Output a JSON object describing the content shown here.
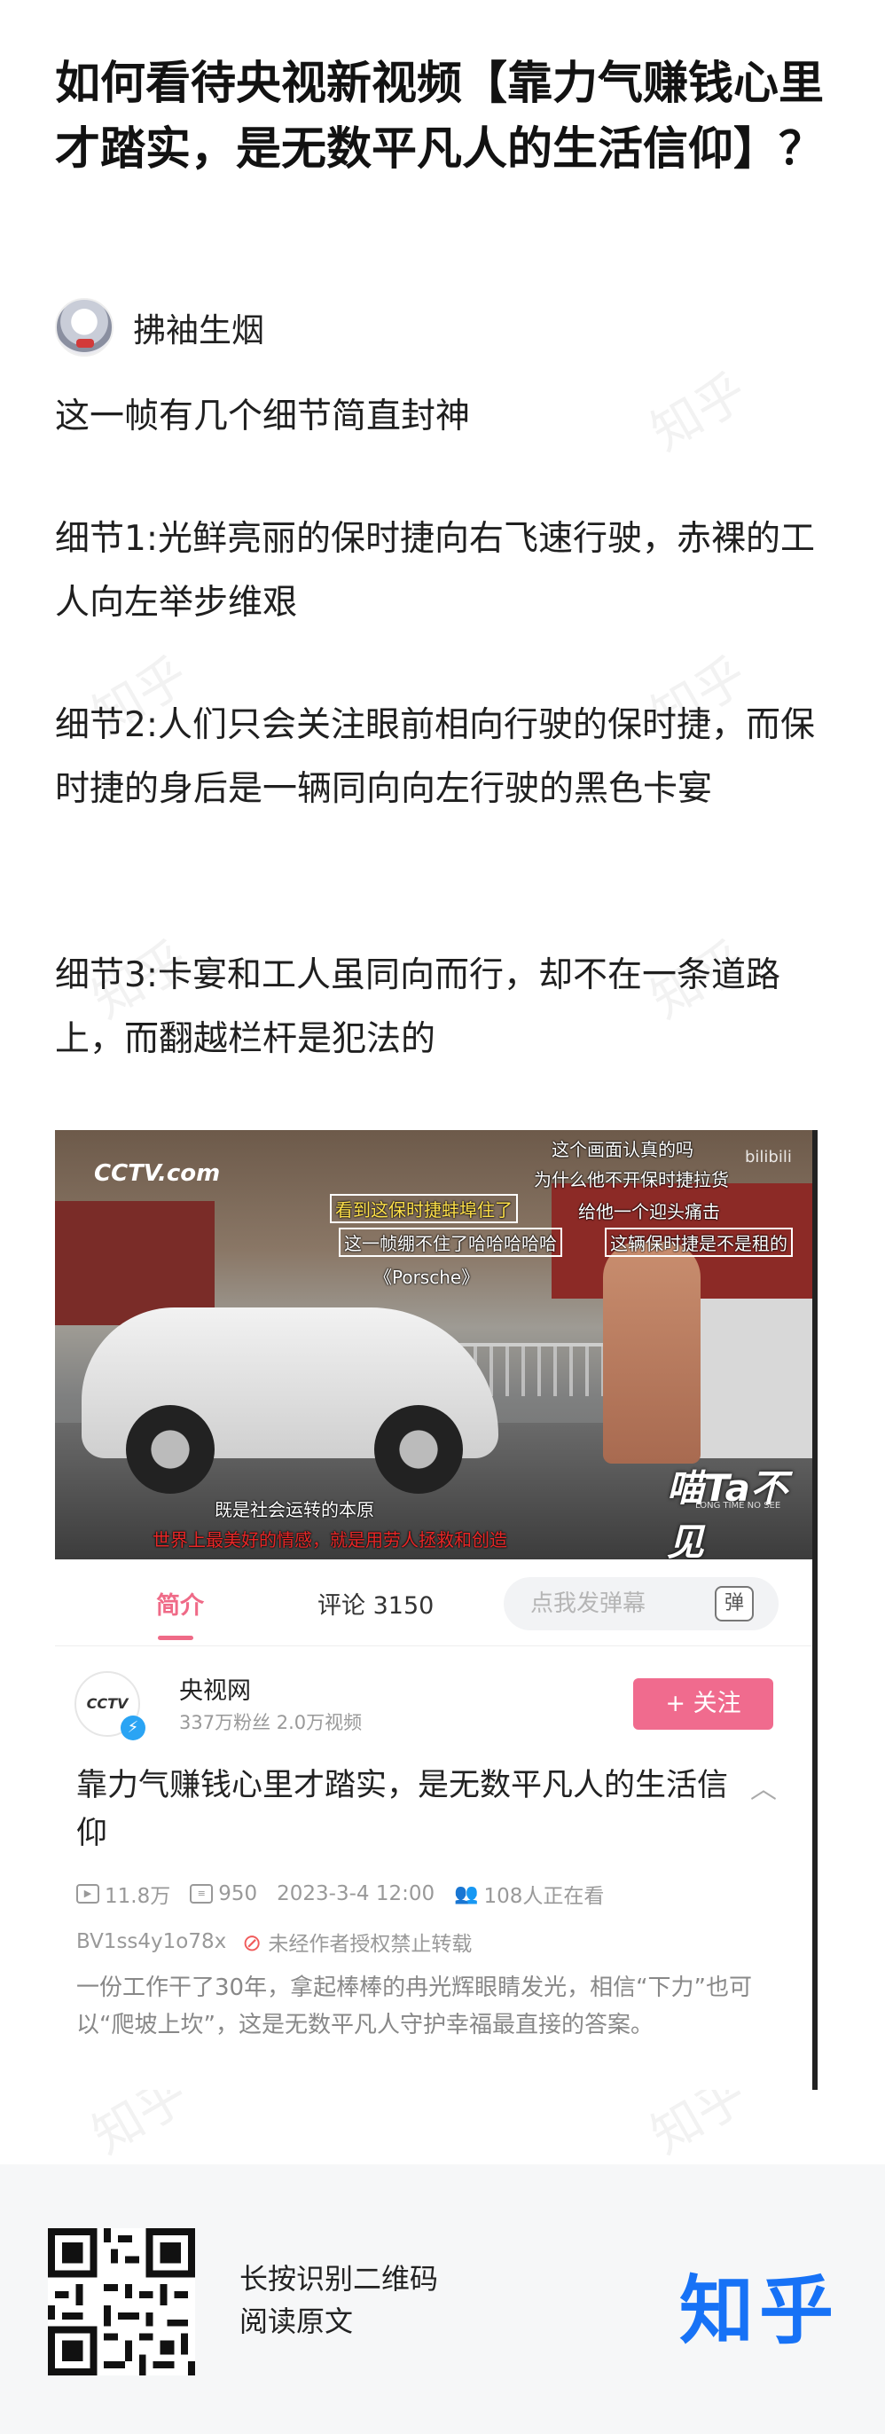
{
  "question": {
    "title": "如何看待央视新视频【靠力气赚钱心里才踏实，是无数平凡人的生活信仰】？"
  },
  "author": {
    "name": "拂袖生烟"
  },
  "paragraphs": [
    "这一帧有几个细节简直封神",
    "细节1:光鲜亮丽的保时捷向右飞速行驶，赤裸的工人向左举步维艰",
    "细节2:人们只会关注眼前相向行驶的保时捷，而保时捷的身后是一辆同向向左行驶的黑色卡宴",
    "细节3:卡宴和工人虽同向而行，却不在一条道路上，而翻越栏杆是犯法的"
  ],
  "watermark": "知乎",
  "screenshot": {
    "channel_logo": "CCTV.com",
    "platform_logo": "bilibili",
    "show_logo": "喵Ta不见",
    "show_logo_sub": "LONG TIME NO SEE",
    "danmaku": [
      "这个画面认真的吗",
      "为什么他不开保时捷拉货",
      "看到这保时捷蚌埠住了",
      "给他一个迎头痛击",
      "这一帧绷不住了哈哈哈哈哈",
      "这辆保时捷是不是租的",
      "《Porsche》",
      "既是社会运转的本原",
      "世界上最美好的情感，就是用劳人拯救和创造"
    ],
    "tabs": {
      "intro": "简介",
      "comments": "评论 3150"
    },
    "danmaku_placeholder": "点我发弹幕",
    "danmaku_button": "弹",
    "uploader": {
      "name": "央视网",
      "avatar_text": "CCTV",
      "meta": "337万粉丝  2.0万视频",
      "follow": "+ 关注"
    },
    "video_title": "靠力气赚钱心里才踏实，是无数平凡人的生活信仰",
    "stats": {
      "plays": "11.8万",
      "danmaku_count": "950",
      "date": "2023-3-4 12:00",
      "watching": "108人正在看"
    },
    "bvid": "BV1ss4y1o78x",
    "reprint_notice": "未经作者授权禁止转载",
    "description": "一份工作干了30年，拿起棒棒的冉光辉眼睛发光，相信“下力”也可以“爬坡上坎”，这是无数平凡人守护幸福最直接的答案。"
  },
  "footer": {
    "line1": "长按识别二维码",
    "line2": "阅读原文",
    "logo": "知乎"
  },
  "colors": {
    "bilibili_pink": "#f06b8e",
    "zhihu_blue": "#1772f6"
  }
}
